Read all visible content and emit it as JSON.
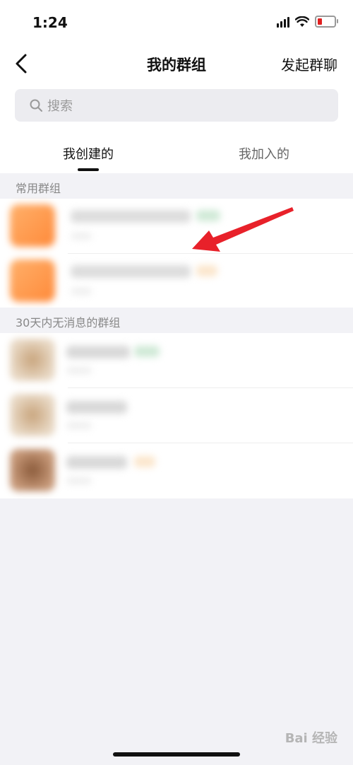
{
  "status": {
    "time": "1:24"
  },
  "nav": {
    "title": "我的群组",
    "action": "发起群聊"
  },
  "search": {
    "placeholder": "搜索"
  },
  "tabs": {
    "created": "我创建的",
    "joined": "我加入的"
  },
  "sections": {
    "frequent": "常用群组",
    "inactive": "30天内无消息的群组"
  },
  "watermark": "Bai 经验",
  "colors": {
    "battery_low": "#e02020",
    "arrow": "#e8212a"
  }
}
